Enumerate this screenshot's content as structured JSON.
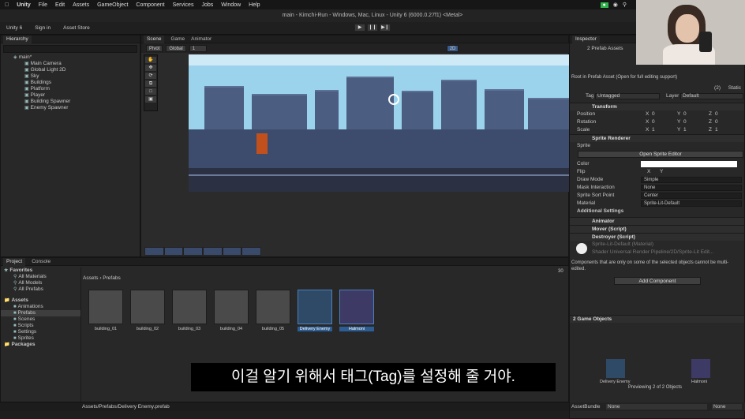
{
  "menubar": {
    "app": "Unity",
    "items": [
      "File",
      "Edit",
      "Assets",
      "GameObject",
      "Component",
      "Services",
      "Jobs",
      "Window",
      "Help"
    ]
  },
  "window_title": "main - Kimchi-Run - Windows, Mac, Linux - Unity 6 (6000.0.27f1) <Metal>",
  "toolbar": {
    "account": "Unity 6",
    "sign_in": "Sign in",
    "asset_store": "Asset Store"
  },
  "hierarchy": {
    "tab": "Hierarchy",
    "scene": "main*",
    "items": [
      "Main Camera",
      "Global Light 2D",
      "Sky",
      "Buildings",
      "Platform",
      "Player",
      "Building Spawner",
      "Enemy Spawner"
    ]
  },
  "scene_tabs": [
    "Scene",
    "Game",
    "Animator"
  ],
  "scene_toolbar": {
    "pivot": "Pivot",
    "global": "Global",
    "grid_value": "1",
    "mode": "2D"
  },
  "project": {
    "tabs": [
      "Project",
      "Console"
    ],
    "favorites": {
      "label": "Favorites",
      "items": [
        "All Materials",
        "All Models",
        "All Prefabs"
      ]
    },
    "assets": {
      "label": "Assets",
      "items": [
        "Animations",
        "Prefabs",
        "Scenes",
        "Scripts",
        "Settings",
        "Sprites"
      ]
    },
    "packages": "Packages",
    "breadcrumb_root": "Assets",
    "breadcrumb_current": "Prefabs",
    "count": "30",
    "files": [
      "building_01",
      "building_02",
      "building_03",
      "building_04",
      "building_05",
      "Delivery Enemy",
      "Halmoni"
    ]
  },
  "status_path": "Assets/Prefabs/Delivery Enemy.prefab",
  "inspector": {
    "tab": "Inspector",
    "header": "2 Prefab Assets",
    "root_note": "Root in Prefab Asset (Open for full editing support)",
    "static": "Static",
    "count_badge": "(2)",
    "tag_label": "Tag",
    "tag_value": "Untagged",
    "layer_label": "Layer",
    "layer_value": "Default",
    "transform": "Transform",
    "position": "Position",
    "rotation": "Rotation",
    "scale": "Scale",
    "pos_vals": [
      "0",
      "0",
      "0"
    ],
    "rot_vals": [
      "0",
      "0",
      "0"
    ],
    "scale_vals": [
      "1",
      "1",
      "1"
    ],
    "axis_x": "X",
    "axis_y": "Y",
    "axis_z": "Z",
    "sprite_renderer": "Sprite Renderer",
    "sprite": "Sprite",
    "open_sprite_editor": "Open Sprite Editor",
    "color": "Color",
    "flip": "Flip",
    "draw_mode": "Draw Mode",
    "draw_mode_value": "Simple",
    "mask_interaction": "Mask Interaction",
    "mask_value": "None",
    "sprite_sort_point": "Sprite Sort Point",
    "sort_value": "Center",
    "material": "Material",
    "material_value": "Sprite-Lit-Default",
    "additional_settings": "Additional Settings",
    "animator": "Animator",
    "mover": "Mover (Script)",
    "destroyer": "Destroyer (Script)",
    "mat_name": "Sprite-Lit-Default (Material)",
    "shader_label": "Shader",
    "shader_value": "Universal Render Pipeline/2D/Sprite-Lit",
    "edit": "Edit...",
    "note": "Components that are only on some of the selected objects cannot be multi-edited.",
    "add_component": "Add Component",
    "game_objects": "2 Game Objects",
    "preview_a": "Delivery Enemy",
    "preview_b": "Halmoni",
    "previewing": "Previewing 2 of 2 Objects",
    "assetbundle": "AssetBundle",
    "ab_value": "None",
    "ab_value2": "None"
  },
  "subtitle": "이걸 알기 위해서 태그(Tag)를 설정해 줄 거야.",
  "colors": {
    "accent": "#2c5d94",
    "sky": "#9cd3ec",
    "building": "#4b5d80"
  }
}
